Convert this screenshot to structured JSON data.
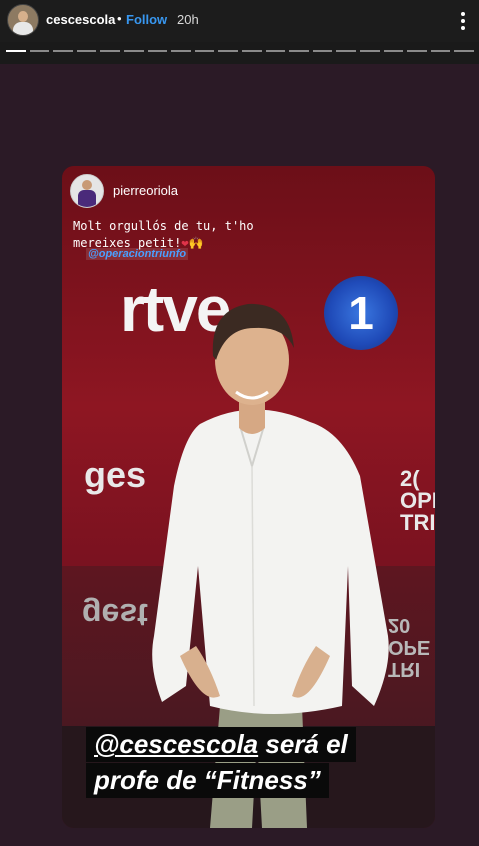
{
  "header": {
    "username": "cescescola",
    "separator": "•",
    "follow_label": "Follow",
    "time": "20h"
  },
  "progress": {
    "segments": 20,
    "active_segment": 1,
    "active_color": "#ffffff",
    "inactive_color": "#8a8a8a"
  },
  "repost": {
    "username": "pierreoriola",
    "caption": "Molt orgullós de tu, t'ho mereixes petit!",
    "caption_emoji": "❤🙌",
    "mention": "@operaciontriunfo",
    "background": {
      "logo_text": "rtve",
      "logo_number": "1",
      "left_text": "ges",
      "left_text_reflection": "gest",
      "right_text": "2( OPE TRI",
      "right_text_reflection": "TRI OPE 20"
    }
  },
  "sticker": {
    "line1_mention": "@cescescola",
    "line1_rest": " será el",
    "line2": "profe de “Fitness”"
  },
  "colors": {
    "follow": "#3897f0",
    "background": "#1a1a1a",
    "story_bg": "#2b1a26"
  }
}
